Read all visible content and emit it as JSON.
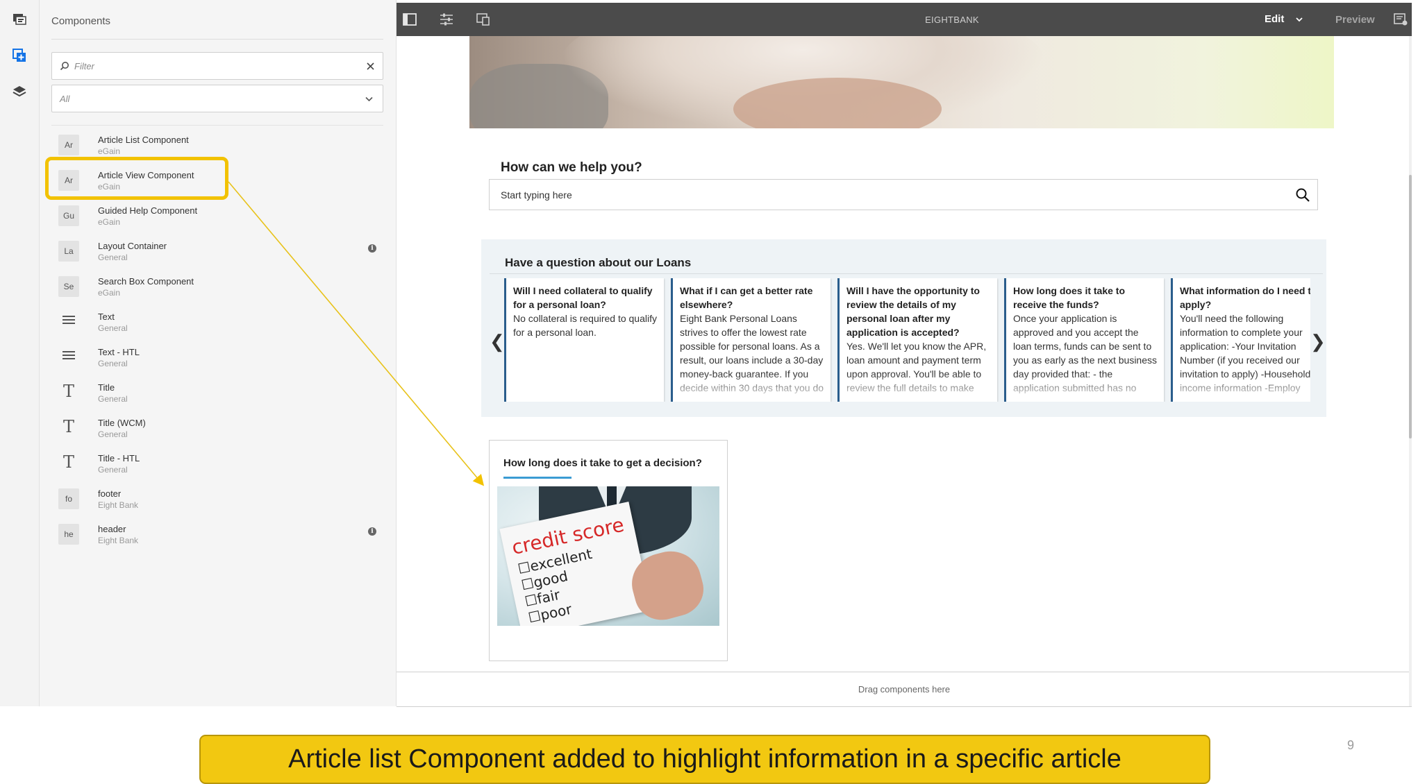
{
  "colors": {
    "toolbar_bg": "#4b4b4b",
    "highlight": "#f2c200",
    "caption_bg": "#f2c811",
    "faq_accent": "#2a5d8c",
    "article_underline": "#3b9bd3"
  },
  "rail": {
    "icons": [
      "page-info-icon",
      "add-component-icon",
      "layers-icon"
    ]
  },
  "panel": {
    "title": "Components",
    "filter_placeholder": "Filter",
    "group_select_value": "All",
    "components": [
      {
        "badge": "Ar",
        "name": "Article List Component",
        "group": "eGain"
      },
      {
        "badge": "Ar",
        "name": "Article View Component",
        "group": "eGain"
      },
      {
        "badge": "Gu",
        "name": "Guided Help Component",
        "group": "eGain"
      },
      {
        "badge": "La",
        "name": "Layout Container",
        "group": "General"
      },
      {
        "badge": "Se",
        "name": "Search Box Component",
        "group": "eGain"
      },
      {
        "icon": "text-lines-icon",
        "name": "Text",
        "group": "General"
      },
      {
        "icon": "text-lines-icon",
        "name": "Text - HTL",
        "group": "General"
      },
      {
        "icon": "title-t-icon",
        "name": "Title",
        "group": "General"
      },
      {
        "icon": "title-t-icon",
        "name": "Title (WCM)",
        "group": "General"
      },
      {
        "icon": "title-t-icon",
        "name": "Title - HTL",
        "group": "General"
      },
      {
        "badge": "fo",
        "name": "footer",
        "group": "Eight Bank"
      },
      {
        "badge": "he",
        "name": "header",
        "group": "Eight Bank"
      }
    ]
  },
  "toolbar": {
    "title": "EIGHTBANK",
    "mode_label": "Edit",
    "preview_label": "Preview"
  },
  "page": {
    "help_title": "How can we help you?",
    "search_placeholder": "Start typing here",
    "loans_title": "Have a question about our Loans",
    "faqs": [
      {
        "q": "Will I need collateral to qualify for a personal loan?",
        "a": "No collateral is required to qualify for a personal loan."
      },
      {
        "q": "What if I can get a better rate elsewhere?",
        "a": "Eight Bank Personal Loans strives to offer the lowest rate possible for personal loans. As a result, our loans include a 30-day money-back guarantee. If you decide within 30 days that you do"
      },
      {
        "q": "Will I have the opportunity to review the details of my personal loan after my application is accepted?",
        "a": "Yes. We'll let you know the APR, loan amount and payment term upon approval. You'll be able to review the full details to make"
      },
      {
        "q": "How long does it take to receive the funds?",
        "a": "Once your application is approved and you accept the loan terms, funds can be sent to you as early as the next business day provided that: - the application submitted has no"
      },
      {
        "q": "What information do I need to apply?",
        "a": "You'll need the following information to complete your application: -Your Invitation Number (if you received our invitation to apply) -Household income information -Employ"
      }
    ],
    "article_title": "How long does it take to get a decision?",
    "article_image": {
      "title": "credit score",
      "items": [
        "excellent",
        "good",
        "fair",
        "poor"
      ]
    },
    "drag_text": "Drag components here"
  },
  "caption": "Article list Component added to highlight information in a specific article",
  "page_number": "9"
}
